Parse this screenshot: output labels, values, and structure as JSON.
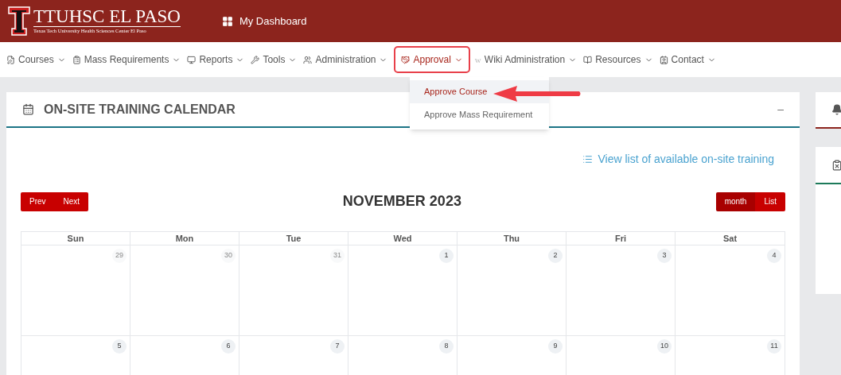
{
  "header": {
    "logo_title": "TTUHSC EL PASO",
    "logo_subtitle": "Texas Tech University Health Sciences Center El Paso",
    "dashboard_link": "My Dashboard"
  },
  "nav": [
    {
      "label": "Courses",
      "selected": false
    },
    {
      "label": "Mass Requirements",
      "selected": false
    },
    {
      "label": "Reports",
      "selected": false
    },
    {
      "label": "Tools",
      "selected": false
    },
    {
      "label": "Administration",
      "selected": false
    },
    {
      "label": "Approval",
      "selected": true
    },
    {
      "label": "Wiki Administration",
      "selected": false,
      "glyph": "w"
    },
    {
      "label": "Resources",
      "selected": false
    },
    {
      "label": "Contact",
      "selected": false
    }
  ],
  "dropdown": [
    {
      "label": "Approve Course",
      "selected": true
    },
    {
      "label": "Approve Mass Requirement",
      "selected": false
    }
  ],
  "calendar_card": {
    "title": "ON-SITE TRAINING CALENDAR",
    "collapse": "–",
    "list_link": "View list of available on-site training",
    "prev": "Prev",
    "next": "Next",
    "month_title": "NOVEMBER 2023",
    "views": [
      {
        "label": "month",
        "selected": true
      },
      {
        "label": "List",
        "selected": false
      }
    ],
    "weekdays": [
      "Sun",
      "Mon",
      "Tue",
      "Wed",
      "Thu",
      "Fri",
      "Sat"
    ],
    "weeks": [
      [
        {
          "day": "29",
          "muted": true
        },
        {
          "day": "30",
          "muted": true
        },
        {
          "day": "31",
          "muted": true
        },
        {
          "day": "1",
          "muted": false
        },
        {
          "day": "2",
          "muted": false
        },
        {
          "day": "3",
          "muted": false
        },
        {
          "day": "4",
          "muted": false
        }
      ],
      [
        {
          "day": "5",
          "muted": false
        },
        {
          "day": "6",
          "muted": false
        },
        {
          "day": "7",
          "muted": false
        },
        {
          "day": "8",
          "muted": false
        },
        {
          "day": "9",
          "muted": false
        },
        {
          "day": "10",
          "muted": false
        },
        {
          "day": "11",
          "muted": false
        }
      ]
    ]
  }
}
